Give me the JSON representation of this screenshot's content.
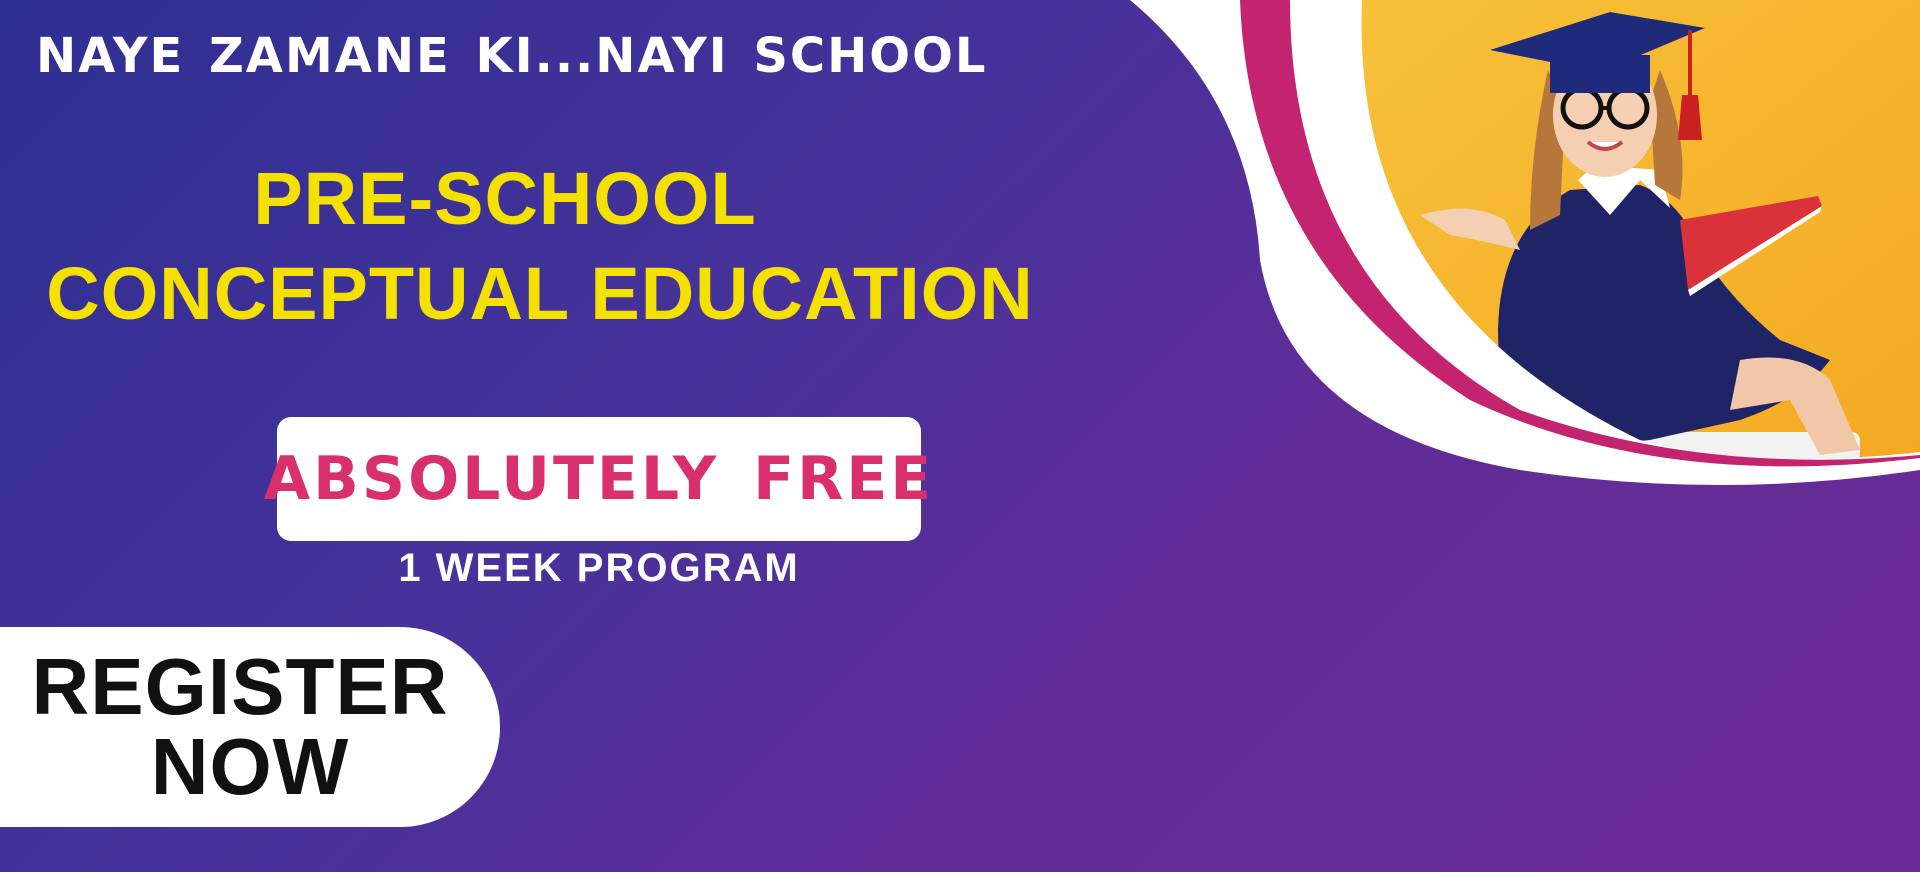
{
  "banner": {
    "tagline": "NAYE ZAMANE  KI...NAYI SCHOOL",
    "headline_line1": "PRE-SCHOOL",
    "headline_line2": "CONCEPTUAL EDUCATION",
    "free_label": "ABSOLUTELY FREE",
    "program_label": "1 WEEK PROGRAM",
    "register_line1": "REGISTER",
    "register_line2": "NOW"
  },
  "colors": {
    "background_start": "#2e2f92",
    "background_end": "#6d2b95",
    "headline": "#f5e100",
    "free_text": "#d92f6c",
    "magenta_curve": "#c4236f",
    "photo_background": "#f7b52c"
  },
  "icons": {
    "photo": "graduate-girl-photo"
  }
}
